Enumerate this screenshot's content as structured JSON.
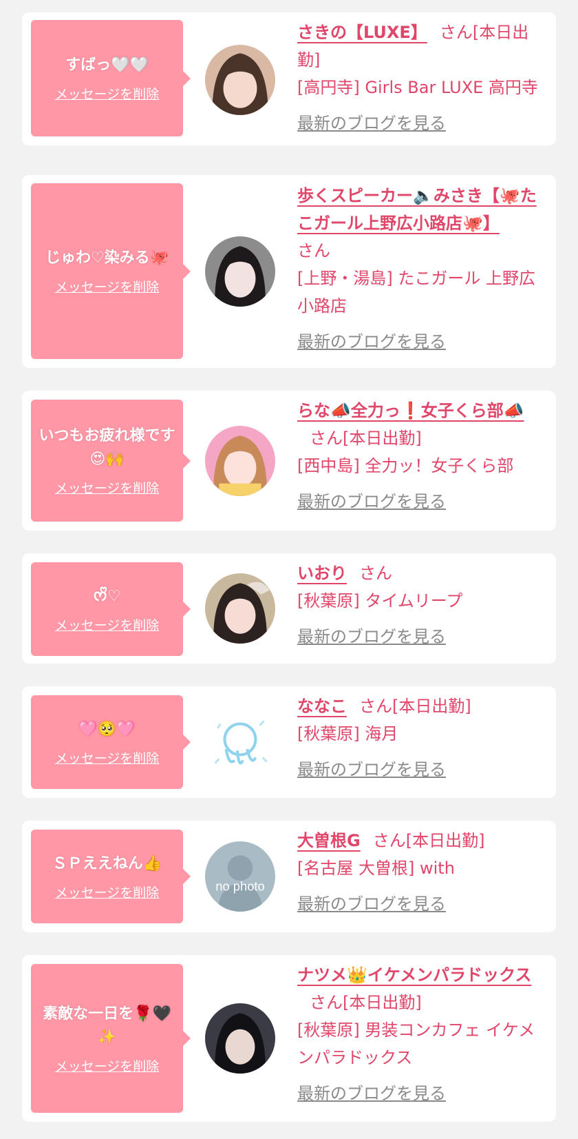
{
  "accent_color": "#e0466a",
  "bubble_color": "#ff97a6",
  "delete_label": "メッセージを削除",
  "blog_label": "最新のブログを見る",
  "entries": [
    {
      "message": "すばっ🤍🤍",
      "name": "さきの【LUXE】",
      "suffix": "さん[本日出勤]",
      "shop": "[高円寺] Girls Bar LUXE 高円寺",
      "avatar_icon": "profile-photo"
    },
    {
      "message": "じゅわ♡染みる🐙",
      "name": "歩くスピーカー🔈みさき【🐙たこガール上野広小路店🐙】",
      "suffix": "さん",
      "shop": "[上野・湯島] たこガール 上野広小路店",
      "avatar_icon": "profile-photo"
    },
    {
      "message": "いつもお疲れ様です😍🙌",
      "name": "らな📣全力っ❗女子くら部📣",
      "suffix": "さん[本日出勤]",
      "shop": "[西中島] 全力ッ！女子くら部",
      "avatar_icon": "profile-photo"
    },
    {
      "message": "ᰔᩚ♡",
      "name": "いおり",
      "suffix": "さん",
      "shop": "[秋葉原] タイムリープ",
      "avatar_icon": "profile-photo"
    },
    {
      "message": "🩷🥺🩷",
      "name": "ななこ",
      "suffix": "さん[本日出勤]",
      "shop": "[秋葉原] 海月",
      "avatar_icon": "shop-logo"
    },
    {
      "message": "ＳＰええねん👍",
      "name": "大曽根G",
      "suffix": "さん[本日出勤]",
      "shop": "[名古屋 大曽根] with",
      "avatar_icon": "no-photo",
      "avatar_text": "no photo"
    },
    {
      "message": "素敵な一日を🌹🖤✨",
      "name": "ナツメ👑イケメンパラドックス",
      "suffix": "さん[本日出勤]",
      "shop": "[秋葉原] 男装コンカフェ イケメンパラドックス",
      "avatar_icon": "profile-photo"
    }
  ]
}
